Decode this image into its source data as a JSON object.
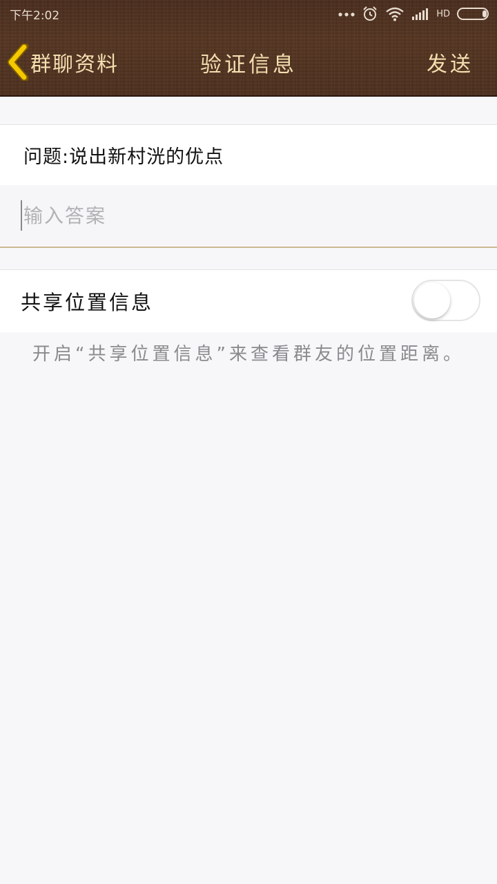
{
  "status_bar": {
    "time": "下午2:02",
    "network": "HD",
    "icons": [
      "more-dots-icon",
      "alarm-icon",
      "wifi-icon",
      "signal-icon",
      "battery-icon"
    ]
  },
  "nav": {
    "back_label": "群聊资料",
    "title": "验证信息",
    "send_label": "发送"
  },
  "question": {
    "text": "问题:说出新村洸的优点"
  },
  "answer": {
    "placeholder": "输入答案",
    "value": ""
  },
  "share_location": {
    "label": "共享位置信息",
    "enabled": false,
    "hint": "开启“共享位置信息”来查看群友的位置距离。"
  },
  "colors": {
    "header_wood": "#4e2f1d",
    "header_text": "#f3dfb0",
    "back_arrow": "#f5c800",
    "divider_accent": "#cdb894",
    "background": "#f7f7f9"
  }
}
